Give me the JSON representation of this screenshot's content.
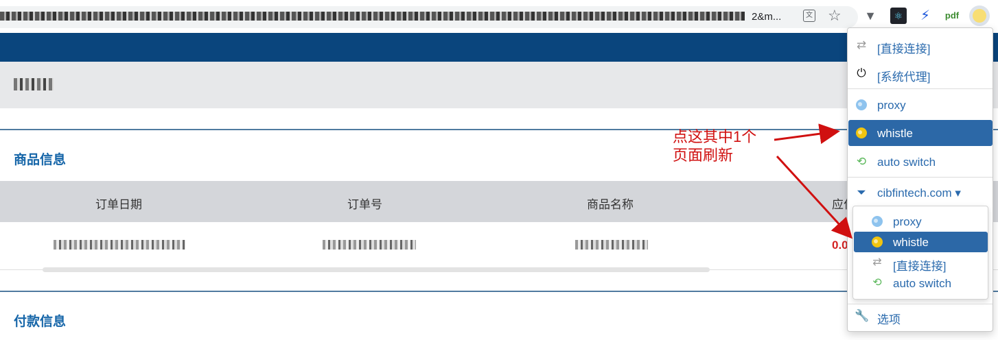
{
  "browser": {
    "url_suffix": "2&m...",
    "translate_icon_glyph": "文",
    "star_glyph": "☆"
  },
  "page": {
    "section1_title": "商品信息",
    "section2_title": "付款信息",
    "columns": [
      "订单日期",
      "订单号",
      "商品名称",
      "应付"
    ],
    "row_amount": "0.0"
  },
  "popup": {
    "items": [
      {
        "label": "[直接连接]",
        "icon": "exchange-icon"
      },
      {
        "label": "[系统代理]",
        "icon": "power-icon"
      },
      {
        "label": "proxy",
        "icon": "globe-icon"
      },
      {
        "label": "whistle",
        "icon": "globe-icon",
        "active": true
      },
      {
        "label": "auto switch",
        "icon": "retweet-icon"
      },
      {
        "label": "cibfintech.com",
        "icon": "filter-icon",
        "caret": "▾"
      },
      {
        "label": "选项",
        "icon": "wrench-icon"
      }
    ],
    "subitems": [
      {
        "label": "proxy",
        "icon": "globe-icon"
      },
      {
        "label": "whistle",
        "icon": "globe-icon",
        "active": true
      },
      {
        "label": "[直接连接]",
        "icon": "exchange-icon"
      },
      {
        "label": "auto switch",
        "icon": "retweet-icon"
      }
    ]
  },
  "annotation": {
    "line1": "点这其中1个",
    "line2": "页面刷新",
    "color": "#d01010"
  },
  "colors": {
    "brand_bar": "#0a457d",
    "active_item": "#2c68a7",
    "link": "#2a6aad",
    "section_title": "#1565a8"
  }
}
